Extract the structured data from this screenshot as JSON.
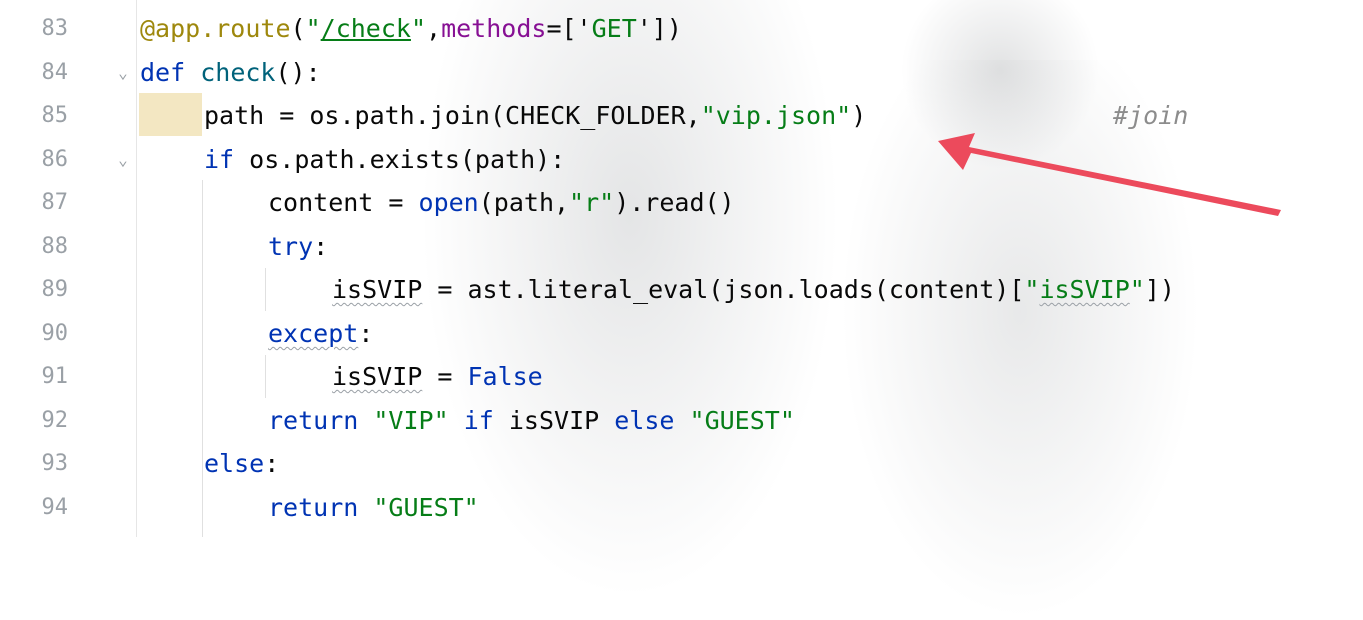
{
  "editor": {
    "lines": [
      {
        "num": "83",
        "fold": "",
        "t": {
          "a": "@app.route",
          "b": "(",
          "c": "\"",
          "d": "/check",
          "e": "\"",
          "f": ",",
          "g": "methods",
          "h": "=['",
          "i": "GET",
          "j": "'])"
        }
      },
      {
        "num": "84",
        "fold": "⌄",
        "t": {
          "a": "def",
          "b": " ",
          "c": "check",
          "d": "():"
        }
      },
      {
        "num": "85",
        "fold": "",
        "t": {
          "a": "path = os.path.join(CHECK_FOLDER,",
          "b": "\"vip.json\"",
          "c": ")",
          "d": "#join"
        }
      },
      {
        "num": "86",
        "fold": "⌄",
        "t": {
          "a": "if",
          "b": " os.path.exists(path):"
        }
      },
      {
        "num": "87",
        "fold": "",
        "t": {
          "a": "content = ",
          "b": "open",
          "c": "(path,",
          "d": "\"r\"",
          "e": ").read()"
        }
      },
      {
        "num": "88",
        "fold": "",
        "t": {
          "a": "try",
          "b": ":"
        }
      },
      {
        "num": "89",
        "fold": "",
        "t": {
          "a": "isSVIP",
          "b": " = ast.literal_eval(json.loads(content)[",
          "c": "\"",
          "d": "isSVIP",
          "e": "\"",
          "f": "])"
        }
      },
      {
        "num": "90",
        "fold": "",
        "t": {
          "a": "except",
          "b": ":"
        }
      },
      {
        "num": "91",
        "fold": "",
        "t": {
          "a": "isSVIP",
          "b": " = ",
          "c": "False"
        }
      },
      {
        "num": "92",
        "fold": "",
        "t": {
          "a": "return",
          "b": " ",
          "c": "\"VIP\"",
          "d": " ",
          "e": "if",
          "f": " isSVIP ",
          "g": "else",
          "h": " ",
          "i": "\"GUEST\""
        }
      },
      {
        "num": "93",
        "fold": "",
        "t": {
          "a": "else",
          "b": ":"
        }
      },
      {
        "num": "94",
        "fold": "",
        "t": {
          "a": "return",
          "b": " ",
          "c": "\"GUEST\""
        }
      }
    ]
  },
  "annotation": {
    "arrow_color": "#ec4a5c"
  },
  "colors": {
    "keyword": "#0033b3",
    "function": "#00627a",
    "string": "#067d17",
    "decorator": "#9e880d",
    "parameter": "#871094",
    "comment": "#8c8c8c"
  }
}
